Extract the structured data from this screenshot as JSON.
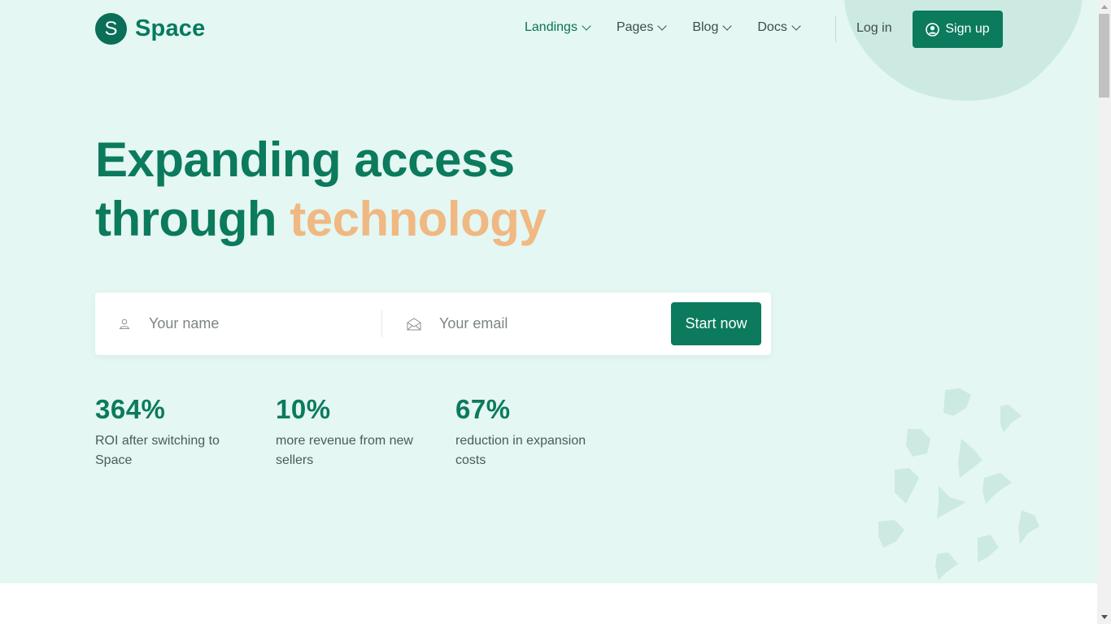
{
  "brand": {
    "name": "Space",
    "mark": "S"
  },
  "nav": {
    "items": [
      {
        "label": "Landings"
      },
      {
        "label": "Pages"
      },
      {
        "label": "Blog"
      },
      {
        "label": "Docs"
      }
    ],
    "login": "Log in",
    "signup": "Sign up"
  },
  "hero": {
    "title_line1": "Expanding access",
    "title_line2_plain": "through",
    "title_line2_accent": "technology"
  },
  "form": {
    "name_placeholder": "Your name",
    "email_placeholder": "Your email",
    "submit": "Start now"
  },
  "stats": [
    {
      "value": "364%",
      "label": "ROI after switching to Space"
    },
    {
      "value": "10%",
      "label": "more revenue from new sellers"
    },
    {
      "value": "67%",
      "label": "reduction in expansion costs"
    }
  ],
  "colors": {
    "primary": "#0b7a5d",
    "accent": "#f0b882",
    "background": "#e4f7f2",
    "blob": "#cdeae2"
  },
  "icons": {
    "name_field": "user-icon",
    "email_field": "envelope-icon",
    "signup": "user-circle-icon",
    "nav_dropdown": "chevron-down-icon"
  }
}
